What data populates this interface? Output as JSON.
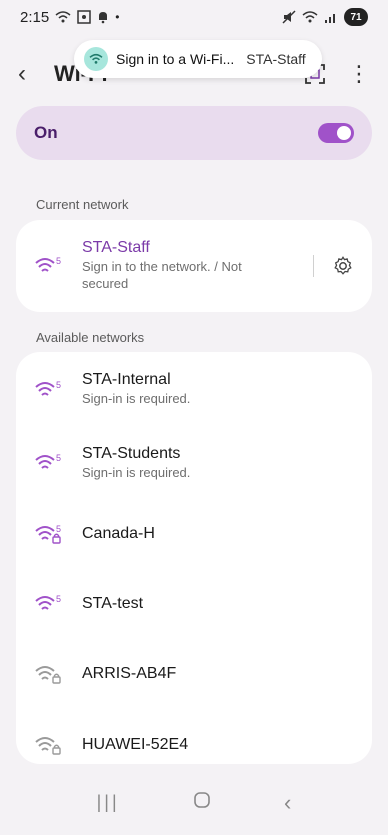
{
  "status": {
    "time": "2:15",
    "battery": "71"
  },
  "toast": {
    "title": "Sign in to a Wi-Fi...",
    "network": "STA-Staff"
  },
  "app_bar": {
    "title": "Wi-Fi"
  },
  "toggle": {
    "label": "On",
    "state": true
  },
  "sections": {
    "current": "Current network",
    "available": "Available networks"
  },
  "current_network": {
    "name": "STA-Staff",
    "status": "Sign in to the network. / Not secured",
    "badge": "5"
  },
  "available_networks": [
    {
      "name": "STA-Internal",
      "status": "Sign-in is required.",
      "badge": "5",
      "locked": false
    },
    {
      "name": "STA-Students",
      "status": "Sign-in is required.",
      "badge": "5",
      "locked": false
    },
    {
      "name": "Canada-H",
      "status": "",
      "badge": "5",
      "locked": true
    },
    {
      "name": "STA-test",
      "status": "",
      "badge": "5",
      "locked": false
    },
    {
      "name": "ARRIS-AB4F",
      "status": "",
      "badge": "",
      "locked": true
    },
    {
      "name": "HUAWEI-52E4",
      "status": "",
      "badge": "",
      "locked": true
    }
  ],
  "colors": {
    "accent": "#a052c9",
    "weak": "#9a9a9a"
  }
}
